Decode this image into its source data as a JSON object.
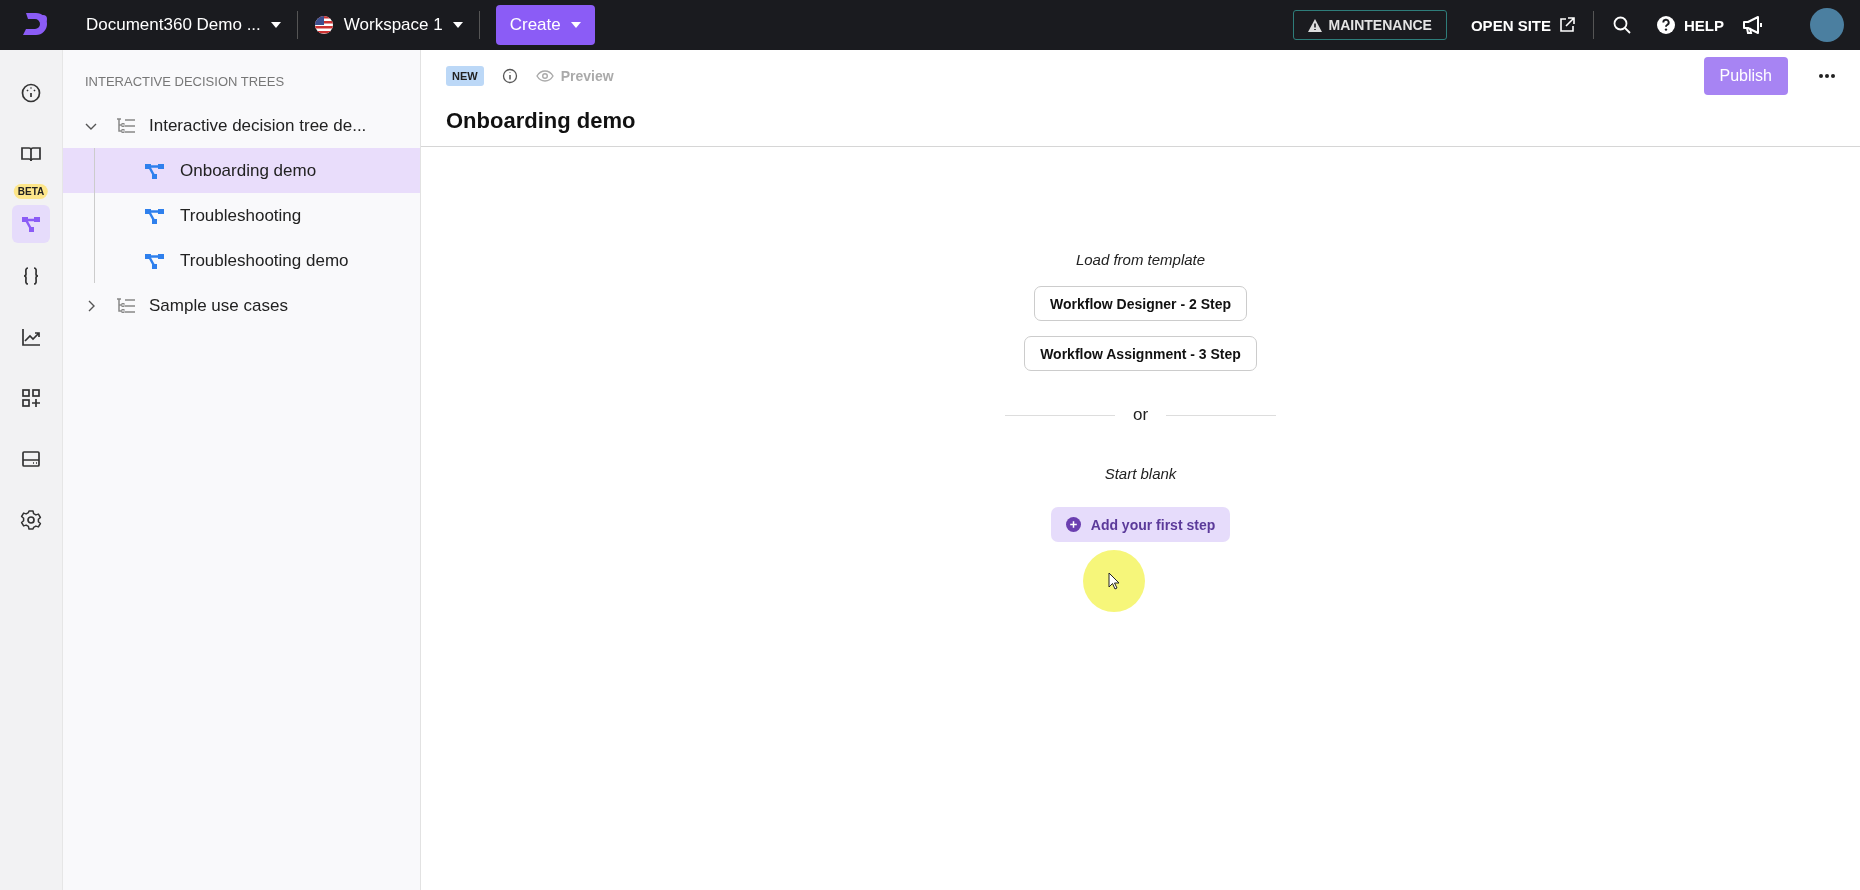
{
  "top_bar": {
    "project": "Document360 Demo ...",
    "workspace": "Workspace 1",
    "create": "Create",
    "maintenance": "MAINTENANCE",
    "open_site": "OPEN SITE",
    "help": "HELP"
  },
  "rail": [
    {
      "kind": "dashboard",
      "selected": false
    },
    {
      "kind": "book",
      "selected": false
    },
    {
      "kind": "tree",
      "selected": true,
      "badge": "BETA"
    },
    {
      "kind": "braces",
      "selected": false
    },
    {
      "kind": "chart",
      "selected": false
    },
    {
      "kind": "apps",
      "selected": false
    },
    {
      "kind": "widget",
      "selected": false
    },
    {
      "kind": "settings",
      "selected": false
    }
  ],
  "tree": {
    "heading": "INTERACTIVE DECISION TREES",
    "items": [
      {
        "kind": "folder",
        "label": "Interactive decision tree de...",
        "expanded": true,
        "selected": false,
        "children": [
          {
            "kind": "tree",
            "label": "Onboarding demo",
            "selected": true
          },
          {
            "kind": "tree",
            "label": "Troubleshooting",
            "selected": false
          },
          {
            "kind": "tree",
            "label": "Troubleshooting demo",
            "selected": false
          }
        ]
      },
      {
        "kind": "folder",
        "label": "Sample use cases",
        "expanded": false,
        "selected": false
      }
    ]
  },
  "editor": {
    "status_badge": "NEW",
    "preview": "Preview",
    "publish": {
      "label": "Publish",
      "disabled": true
    },
    "title": "Onboarding demo"
  },
  "canvas": {
    "template_heading": "Load from template",
    "templates": [
      "Workflow Designer - 2 Step",
      "Workflow Assignment - 3 Step"
    ],
    "divider": "or",
    "blank_heading": "Start blank",
    "add_step": "Add your first step"
  }
}
